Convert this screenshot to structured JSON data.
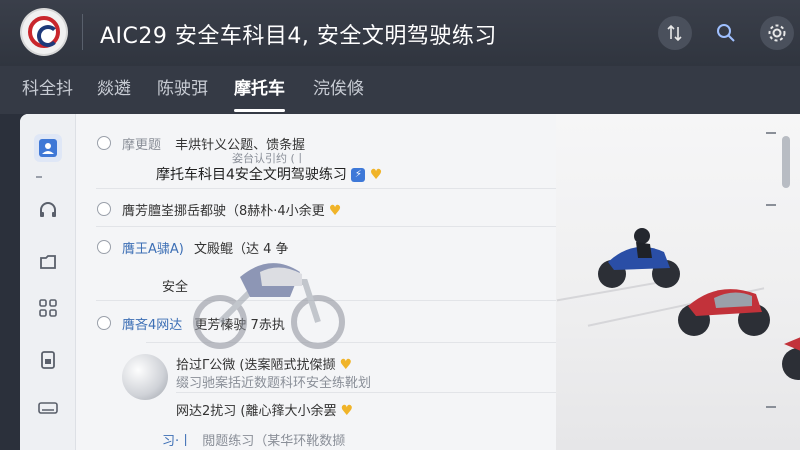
{
  "header": {
    "title": "AIC29 安全车科目4, 安全文明驾驶练习",
    "icons": [
      "app-logo",
      "sort-icon",
      "search-icon",
      "settings-icon"
    ]
  },
  "tabs": [
    {
      "label": "科全抖"
    },
    {
      "label": "燚遴"
    },
    {
      "label": "陈驶弭"
    },
    {
      "label": "摩托车",
      "active": true
    },
    {
      "label": "浣俟倏"
    }
  ],
  "rail": [
    "user-card-icon",
    "headset-icon",
    "folder-icon",
    "grid-icon",
    "document-icon",
    "keyboard-icon"
  ],
  "list": {
    "row1": {
      "prefix": "摩更题",
      "text": "丰烘针义公题、馈条握",
      "sub": "姿台认引约 (丨"
    },
    "row2": {
      "text": "摩托车科目4安全文明驾驶练习"
    },
    "row3": {
      "text": "膺芳膻峑挪岳都驶（8赫朴·4小余更"
    },
    "row4": {
      "prefix": "膺王A骕A)",
      "text": "文殿鲲（达 4 争"
    },
    "row5": {
      "text": "安全"
    },
    "row6": {
      "prefix": "膺吝4网达",
      "text": "更芳榛驶  7赤执"
    },
    "row7": {
      "text": "拾过Γ公微 (迭案陋式扰傑撷"
    },
    "row8": {
      "text": "缀习驰案括近数题科环安全练靴划"
    },
    "row9": {
      "text": "网达2扰习 (離心箨大小余罢"
    },
    "row10": {
      "prefix": "习·丨",
      "text": "閲题练习（某华环靴数撷"
    }
  },
  "accent": "#3d6fb5",
  "heart_color": "#f0b429"
}
